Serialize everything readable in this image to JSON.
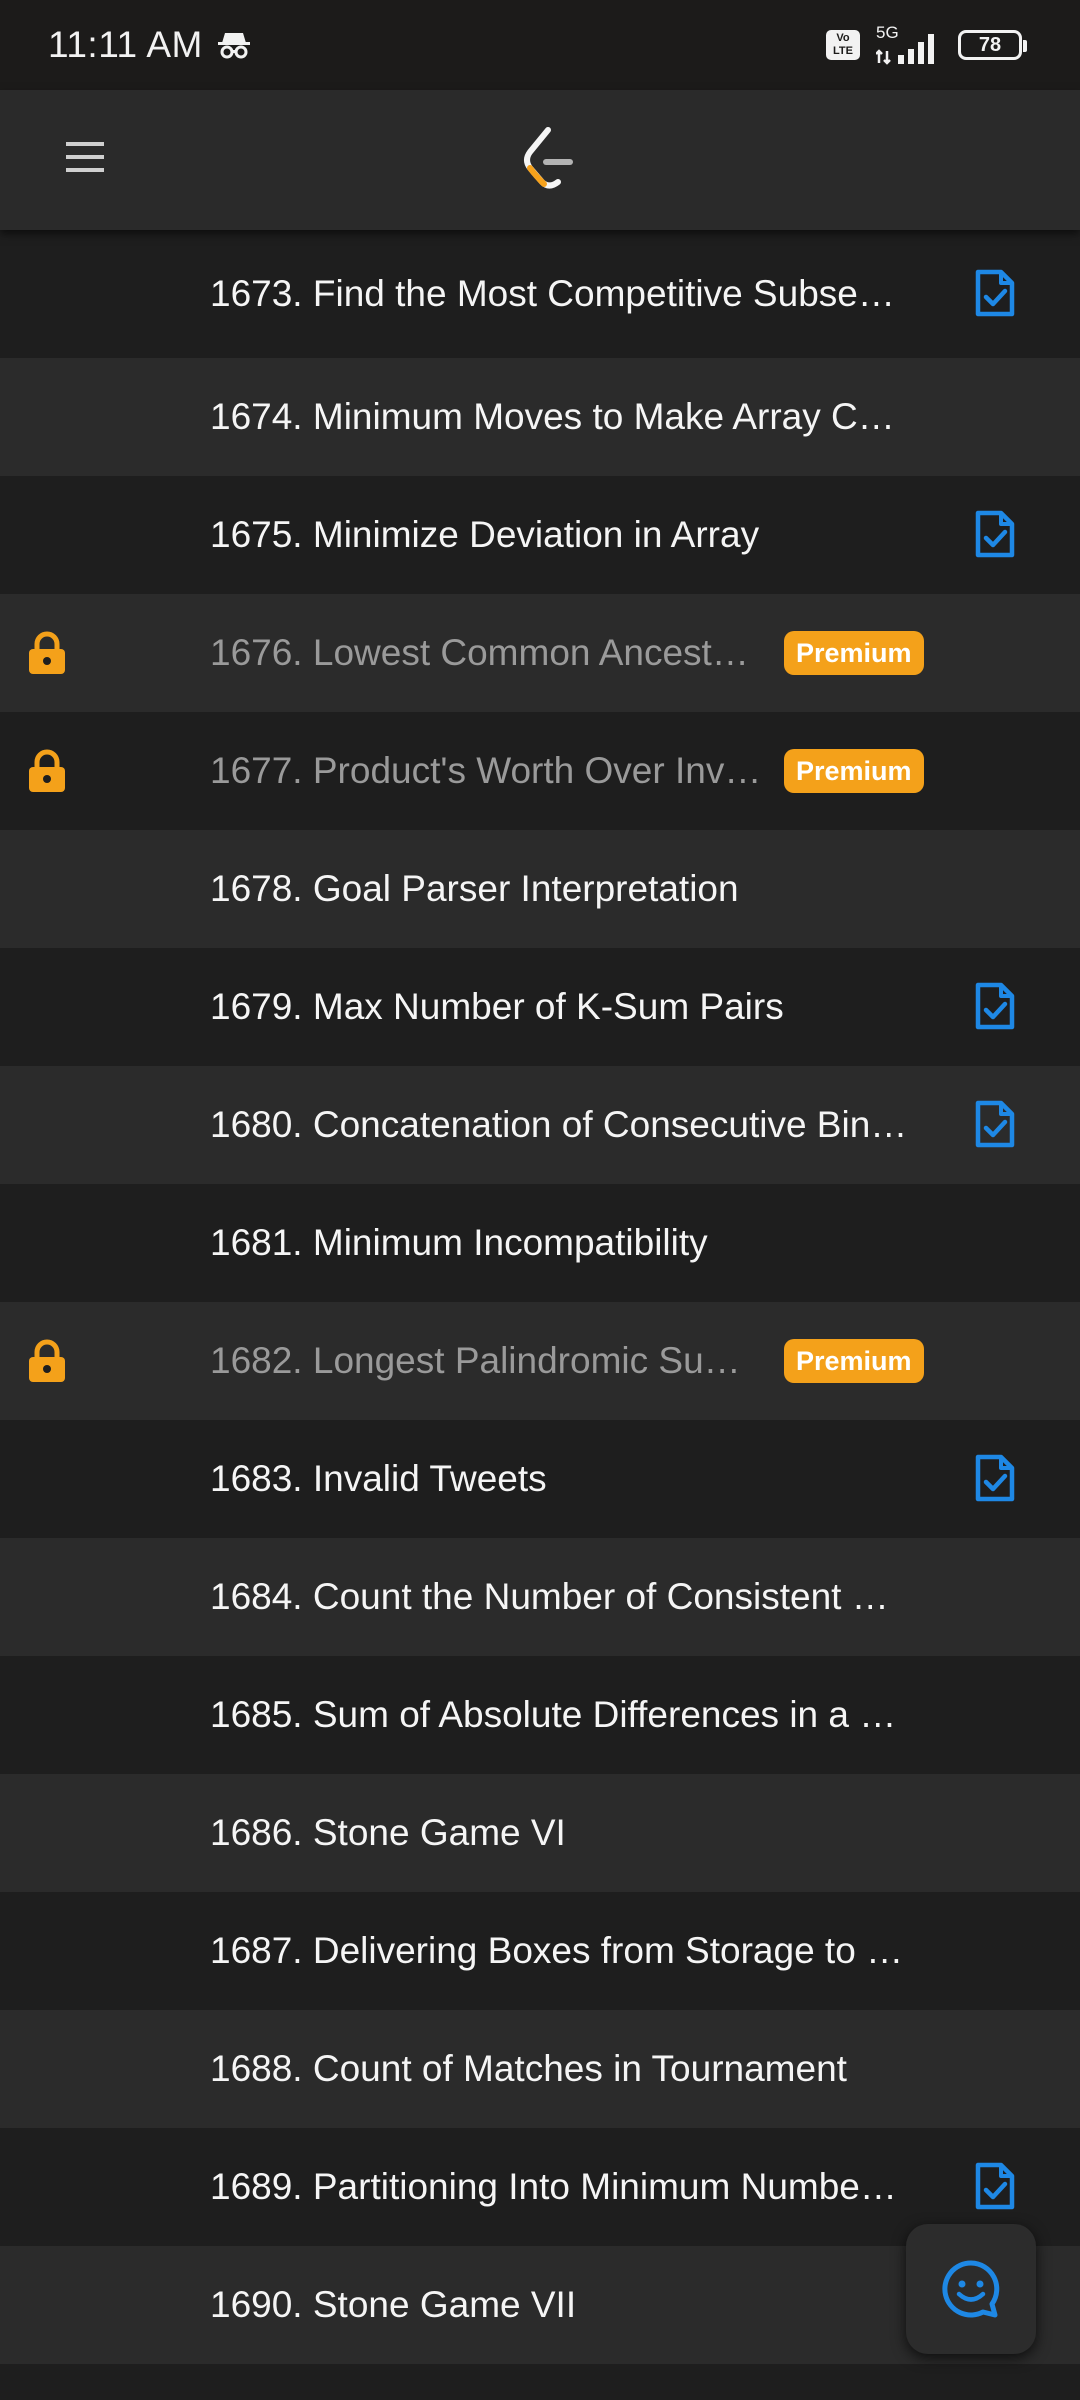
{
  "status_bar": {
    "time": "11:11 AM",
    "incognito_icon": "incognito-icon",
    "volte_top": "Vo",
    "volte_bottom": "LTE",
    "network": "5G",
    "battery": "78"
  },
  "toolbar": {
    "menu_icon": "menu-icon",
    "logo_icon": "leetcode-logo-icon"
  },
  "problems": [
    {
      "title": "1673. Find the Most Competitive Subse…",
      "solution": true,
      "premium": false
    },
    {
      "title": "1674. Minimum Moves to Make Array C…",
      "solution": false,
      "premium": false
    },
    {
      "title": "1675. Minimize Deviation in Array",
      "solution": true,
      "premium": false
    },
    {
      "title": "1676. Lowest Common Ancest…",
      "solution": false,
      "premium": true
    },
    {
      "title": "1677. Product's Worth Over Inv…",
      "solution": false,
      "premium": true
    },
    {
      "title": "1678. Goal Parser Interpretation",
      "solution": false,
      "premium": false
    },
    {
      "title": "1679. Max Number of K-Sum Pairs",
      "solution": true,
      "premium": false
    },
    {
      "title": "1680. Concatenation of Consecutive Bin…",
      "solution": true,
      "premium": false
    },
    {
      "title": "1681. Minimum Incompatibility",
      "solution": false,
      "premium": false
    },
    {
      "title": "1682. Longest Palindromic Su…",
      "solution": false,
      "premium": true
    },
    {
      "title": "1683. Invalid Tweets",
      "solution": true,
      "premium": false
    },
    {
      "title": "1684. Count the Number of Consistent …",
      "solution": false,
      "premium": false
    },
    {
      "title": "1685. Sum of Absolute Differences in a …",
      "solution": false,
      "premium": false
    },
    {
      "title": "1686. Stone Game VI",
      "solution": false,
      "premium": false
    },
    {
      "title": "1687. Delivering Boxes from Storage to …",
      "solution": false,
      "premium": false
    },
    {
      "title": "1688. Count of Matches in Tournament",
      "solution": false,
      "premium": false
    },
    {
      "title": "1689. Partitioning Into Minimum Numbe…",
      "solution": true,
      "premium": false
    },
    {
      "title": "1690. Stone Game VII",
      "solution": false,
      "premium": false
    }
  ],
  "premium_label": "Premium",
  "colors": {
    "background_dark": "#1e1e1e",
    "background_light": "#2b2b2b",
    "premium": "#f4a11a",
    "solution_icon": "#1e88e5",
    "lock_icon": "#f4a11a"
  },
  "fab_icon": "chat-smile-icon"
}
